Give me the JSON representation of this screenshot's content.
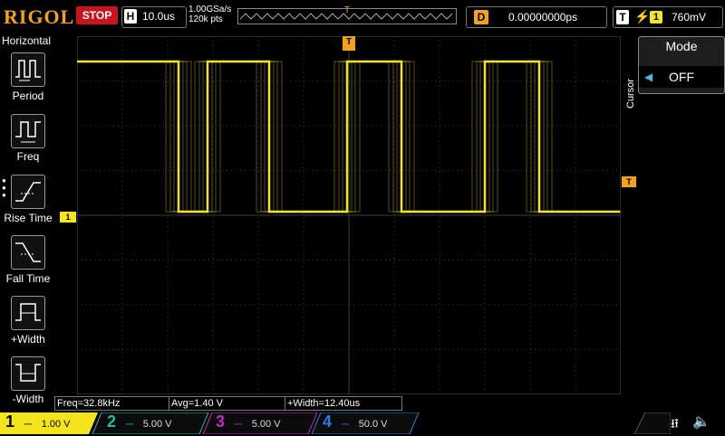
{
  "brand": "RIGOL",
  "run_state": "STOP",
  "horizontal": {
    "badge": "H",
    "timebase": "10.0us",
    "sample_rate": "1.00GSa/s",
    "memory_depth": "120k pts"
  },
  "trigger_position_marker": "T",
  "delay": {
    "badge": "D",
    "value": "0.00000000ps"
  },
  "trigger": {
    "badge": "T",
    "edge_symbol": "⚡",
    "source": "1",
    "level": "760mV"
  },
  "left_menu": {
    "title": "Horizontal",
    "items": [
      {
        "label": "Period"
      },
      {
        "label": "Freq"
      },
      {
        "label": "Rise Time"
      },
      {
        "label": "Fall Time"
      },
      {
        "label": "+Width"
      },
      {
        "label": "-Width"
      }
    ]
  },
  "right_panel": {
    "side_label": "Cursor",
    "mode_title": "Mode",
    "mode_value": "OFF"
  },
  "markers": {
    "ch1": "1",
    "trigger_level": "T"
  },
  "measurements": [
    {
      "text": "Freq=32.8kHz"
    },
    {
      "text": "Avg=1.40 V"
    },
    {
      "text": "+Width=12.40us"
    }
  ],
  "channels": [
    {
      "num": "1",
      "scale": "1.00 V",
      "color": "#f5e61b",
      "active": true
    },
    {
      "num": "2",
      "scale": "5.00 V",
      "color": "#1fb9a6",
      "active": false
    },
    {
      "num": "3",
      "scale": "5.00 V",
      "color": "#c02ac0",
      "active": false
    },
    {
      "num": "4",
      "scale": "50.0 V",
      "color": "#2a7ae0",
      "active": false
    }
  ],
  "colors": {
    "trace": "#f5e61b",
    "accent": "#f5a21b",
    "stop": "#c8141e",
    "grid": "#3c3c3c"
  }
}
